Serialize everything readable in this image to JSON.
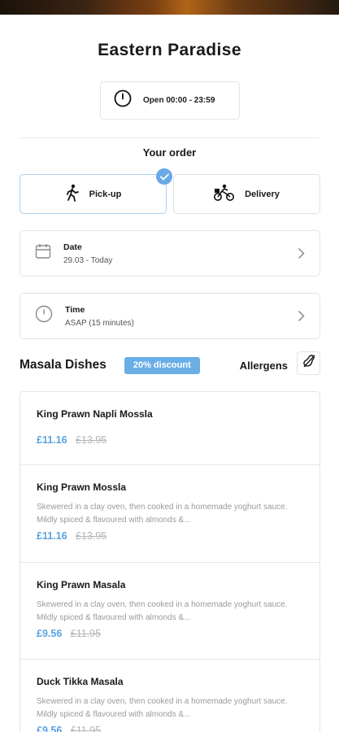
{
  "restaurant": {
    "name": "Eastern Paradise",
    "hours": "Open 00:00 - 23:59"
  },
  "order": {
    "heading": "Your order",
    "modes": [
      {
        "label": "Pick-up",
        "icon": "walking-person-icon",
        "selected": true
      },
      {
        "label": "Delivery",
        "icon": "bicycle-icon",
        "selected": false
      }
    ],
    "date": {
      "label": "Date",
      "value": "29.03 - Today"
    },
    "time": {
      "label": "Time",
      "value": "ASAP (15 minutes)"
    }
  },
  "menu": {
    "category": "Masala Dishes",
    "badge": "20% discount",
    "allergens_label": "Allergens",
    "dishes": [
      {
        "name": "King Prawn Napli Mossla",
        "description": "",
        "price": "£11.16",
        "old_price": "£13.95"
      },
      {
        "name": "King Prawn Mossla",
        "description": "Skewered in a clay oven, then cooked in a homemade yoghurt sauce. Mildly spiced & flavoured with almonds &...",
        "price": "£11.16",
        "old_price": "£13.95"
      },
      {
        "name": "King Prawn Masala",
        "description": "Skewered in a clay oven, then cooked in a homemade yoghurt sauce. Mildly spiced & flavoured with almonds &...",
        "price": "£9.56",
        "old_price": "£11.95"
      },
      {
        "name": "Duck Tikka Masala",
        "description": "Skewered in a clay oven, then cooked in a homemade yoghurt sauce. Mildly spiced & flavoured with almonds &...",
        "price": "£9.56",
        "old_price": "£11.95"
      }
    ]
  },
  "colors": {
    "accent": "#69a9e4",
    "price": "#5aa2e0",
    "old_price": "#b5b5b5",
    "border": "#e3e3e3"
  }
}
